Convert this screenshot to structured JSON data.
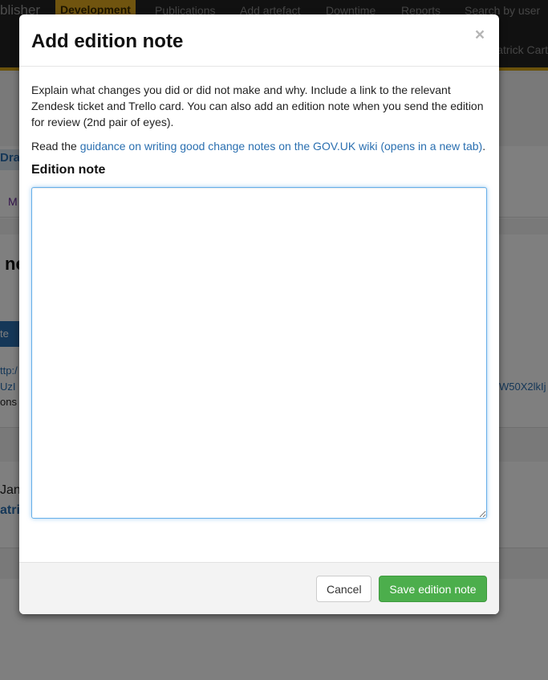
{
  "background": {
    "brand": "blisher",
    "environment": "Development",
    "nav_items": [
      "Publications",
      "Add artefact",
      "Downtime",
      "Reports",
      "Search by user"
    ],
    "user": "atrick Cart",
    "fragments": {
      "tab": "Dra",
      "link_m": "M",
      "heading": "ne",
      "button": "te",
      "url_1": "ttp:/",
      "url_2": "UzI",
      "url_right": "W50X2lkIj",
      "ons": "ons",
      "date": "Jan",
      "author": "atri"
    }
  },
  "modal": {
    "title": "Add edition note",
    "close_label": "×",
    "intro": "Explain what changes you did or did not make and why. Include a link to the relevant Zendesk ticket and Trello card. You can also add an edition note when you send the edition for review (2nd pair of eyes).",
    "guidance_prefix": "Read the ",
    "guidance_link": "guidance on writing good change notes on the GOV.UK wiki (opens in a new tab)",
    "guidance_suffix": ".",
    "field_label": "Edition note",
    "field_value": "",
    "cancel_label": "Cancel",
    "save_label": "Save edition note"
  },
  "colors": {
    "navbar": "#232323",
    "env_badge": "#e0a91f",
    "link": "#2a6fb0",
    "save_button": "#4cae4c",
    "focus_border": "#66afe9"
  }
}
